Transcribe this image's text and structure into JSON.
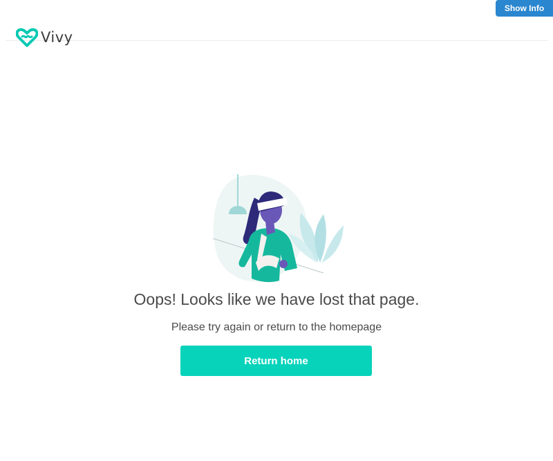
{
  "debug": {
    "show_info_label": "Show Info"
  },
  "header": {
    "logo_text": "Vivy"
  },
  "error": {
    "title": "Oops! Looks like we have lost that page.",
    "subtitle": "Please try again or return to the homepage",
    "button_label": "Return home"
  },
  "colors": {
    "brand_teal": "#07d3bb",
    "info_blue": "#2a86cf",
    "text": "#4a4a4a"
  }
}
